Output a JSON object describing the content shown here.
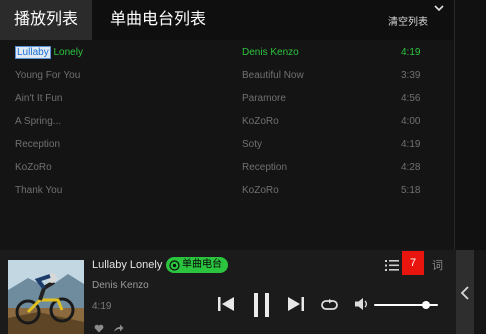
{
  "tabs": {
    "playlist_label": "播放列表",
    "radio_list_label": "单曲电台列表"
  },
  "toolbar": {
    "clear_label": "清空列表"
  },
  "tracks": [
    {
      "title_highlight": "Lullaby",
      "title_rest": " Lonely",
      "artist": "Denis Kenzo",
      "duration": "4:19",
      "playing": true
    },
    {
      "title": "Young For You",
      "artist": "Beautiful Now",
      "duration": "3:39"
    },
    {
      "title": "Ain't It Fun",
      "artist": "Paramore",
      "duration": "4:56"
    },
    {
      "title": "A Spring...",
      "artist": "KoZoRo",
      "duration": "4:00"
    },
    {
      "title": "Reception",
      "artist": "Soty",
      "duration": "4:19"
    },
    {
      "title": "KoZoRo",
      "artist": "Reception",
      "duration": "4:28"
    },
    {
      "title": "Thank You",
      "artist": "KoZoRo",
      "duration": "5:18"
    }
  ],
  "now_playing": {
    "title": "Lullaby Lonely",
    "artist": "Denis Kenzo",
    "time": "4:19",
    "badge_label": "单曲电台",
    "queue_count": "7",
    "lyrics_label": "词",
    "volume": 0.82
  },
  "colors": {
    "accent_green": "#2bc43e",
    "badge_red": "#e8140e",
    "background": "#141414"
  },
  "icons": [
    "chevron-down-icon",
    "radio-icon",
    "heart-icon",
    "share-icon",
    "previous-icon",
    "pause-icon",
    "next-icon",
    "repeat-icon",
    "volume-icon",
    "playlist-icon",
    "chevron-left-icon"
  ]
}
